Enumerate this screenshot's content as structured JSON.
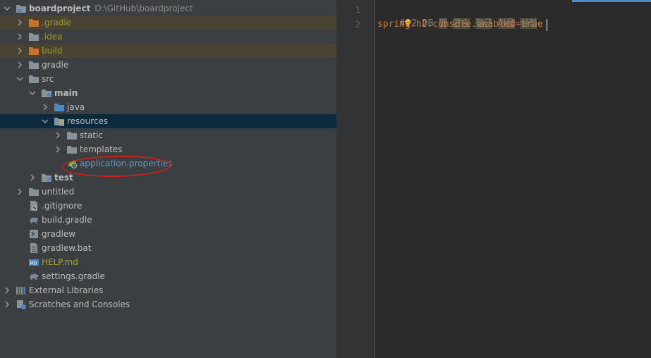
{
  "project_tree": {
    "root": {
      "label": "boardproject",
      "path": "D:\\GitHub\\boardproject"
    },
    "items": [
      {
        "label": ".gradle"
      },
      {
        "label": ".idea"
      },
      {
        "label": "build"
      },
      {
        "label": "gradle"
      },
      {
        "label": "src"
      },
      {
        "label": "main"
      },
      {
        "label": "java"
      },
      {
        "label": "resources"
      },
      {
        "label": "static"
      },
      {
        "label": "templates"
      },
      {
        "label": "application.properties"
      },
      {
        "label": "test"
      },
      {
        "label": "untitled"
      },
      {
        "label": ".gitignore"
      },
      {
        "label": "build.gradle"
      },
      {
        "label": "gradlew"
      },
      {
        "label": "gradlew.bat"
      },
      {
        "label": "HELP.md"
      },
      {
        "label": "settings.gradle"
      },
      {
        "label": "External Libraries"
      },
      {
        "label": "Scratches and Consoles"
      }
    ]
  },
  "editor": {
    "line_numbers": [
      "1",
      "2"
    ],
    "line1": {
      "prefix": "#",
      "rest": "2 DB ",
      "k1": "웹",
      "k2": "콘솔",
      "k3": "접근",
      "k4": "허용",
      "k5": "설정"
    },
    "line2": "spring.h2.console.enabled=true"
  },
  "colors": {
    "annotation": "#cc1f1f",
    "selection": "#0d293e",
    "ignored_row": "#4a4232"
  }
}
